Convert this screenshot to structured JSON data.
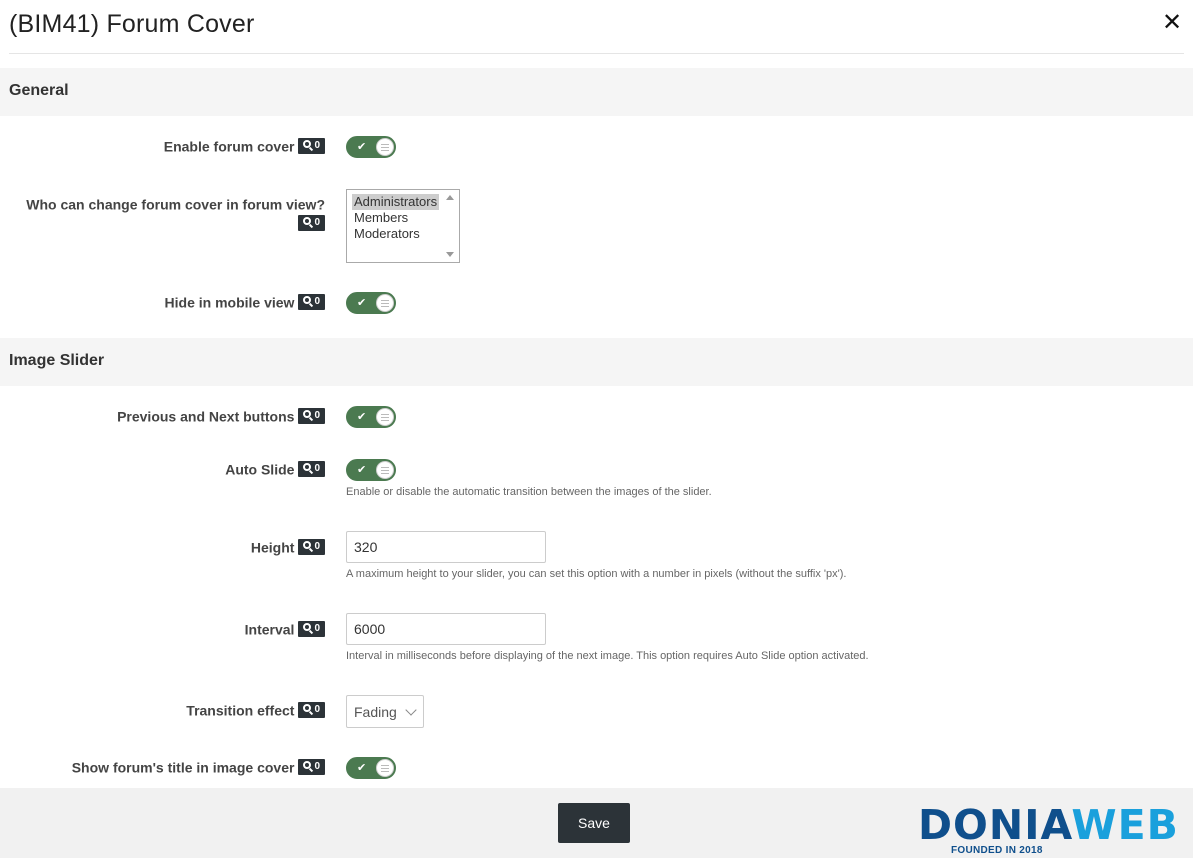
{
  "modal": {
    "title": "(BIM41) Forum Cover",
    "close_symbol": "✕"
  },
  "badge_count": "0",
  "sections": {
    "general": "General",
    "image_slider": "Image Slider"
  },
  "fields": {
    "enable_cover": {
      "label": "Enable forum cover",
      "enabled": true
    },
    "who_can_change": {
      "label": "Who can change forum cover in forum view?",
      "options": [
        "Administrators",
        "Members",
        "Moderators"
      ],
      "selected": "Administrators"
    },
    "hide_mobile": {
      "label": "Hide in mobile view",
      "enabled": true
    },
    "prev_next": {
      "label": "Previous and Next buttons",
      "enabled": true
    },
    "auto_slide": {
      "label": "Auto Slide",
      "enabled": true,
      "help": "Enable or disable the automatic transition between the images of the slider."
    },
    "height": {
      "label": "Height",
      "value": "320",
      "help": "A maximum height to your slider, you can set this option with a number in pixels (without the suffix 'px')."
    },
    "interval": {
      "label": "Interval",
      "value": "6000",
      "help": "Interval in milliseconds before displaying of the next image. This option requires Auto Slide option activated."
    },
    "transition": {
      "label": "Transition effect",
      "value": "Fading"
    },
    "show_title": {
      "label": "Show forum's title in image cover",
      "enabled": true
    }
  },
  "footer": {
    "save_label": "Save"
  },
  "watermark": {
    "part1": "DONIA",
    "part2": "WEB",
    "tagline": "FOUNDED IN 2018"
  },
  "colors": {
    "toggle_on": "#4b7a50",
    "badge_bg": "#2c3338",
    "save_bg": "#2c3338",
    "section_bg": "#f5f5f5",
    "logo_dark": "#0f4f8c",
    "logo_light": "#1aa0dc"
  },
  "icons": {
    "close": "close-icon",
    "badge": "search-icon",
    "toggle_on": "check-icon",
    "toggle_knob": "grip-icon",
    "select_arrow": "chevron-down-icon"
  }
}
